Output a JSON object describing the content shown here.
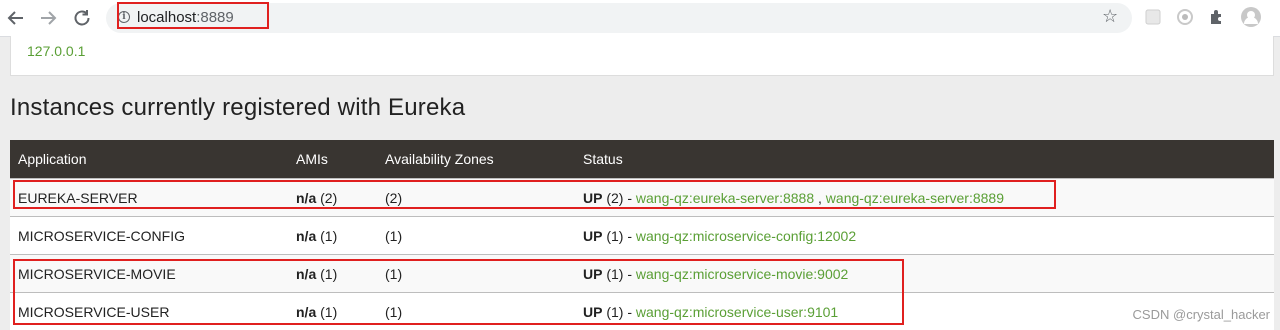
{
  "browser": {
    "url_host": "localhost",
    "url_port": ":8889"
  },
  "ip_panel": {
    "value": "127.0.0.1"
  },
  "section": {
    "title": "Instances currently registered with Eureka"
  },
  "table": {
    "headers": {
      "application": "Application",
      "amis": "AMIs",
      "zones": "Availability Zones",
      "status": "Status"
    },
    "rows": [
      {
        "application": "EUREKA-SERVER",
        "ami_na": "n/a",
        "ami_count": " (2)",
        "zones": "(2)",
        "status_up": "UP",
        "status_count": " (2) - ",
        "links": [
          "wang-qz:eureka-server:8888",
          "wang-qz:eureka-server:8889"
        ],
        "separator": " , "
      },
      {
        "application": "MICROSERVICE-CONFIG",
        "ami_na": "n/a",
        "ami_count": " (1)",
        "zones": "(1)",
        "status_up": "UP",
        "status_count": " (1) - ",
        "links": [
          "wang-qz:microservice-config:12002"
        ]
      },
      {
        "application": "MICROSERVICE-MOVIE",
        "ami_na": "n/a",
        "ami_count": " (1)",
        "zones": "(1)",
        "status_up": "UP",
        "status_count": " (1) - ",
        "links": [
          "wang-qz:microservice-movie:9002"
        ]
      },
      {
        "application": "MICROSERVICE-USER",
        "ami_na": "n/a",
        "ami_count": " (1)",
        "zones": "(1)",
        "status_up": "UP",
        "status_count": " (1) - ",
        "links": [
          "wang-qz:microservice-user:9101"
        ]
      }
    ]
  },
  "watermark": "CSDN @crystal_hacker",
  "icons": {
    "back": "back-arrow-icon",
    "forward": "forward-arrow-icon",
    "reload": "reload-icon",
    "info": "info-icon",
    "star": "bookmark-star-icon",
    "extensions": "puzzle-icon",
    "profile": "profile-avatar-icon"
  },
  "colors": {
    "header_bg": "#393531",
    "link_green": "#5a9f35",
    "annotation_red": "#e0201f"
  }
}
